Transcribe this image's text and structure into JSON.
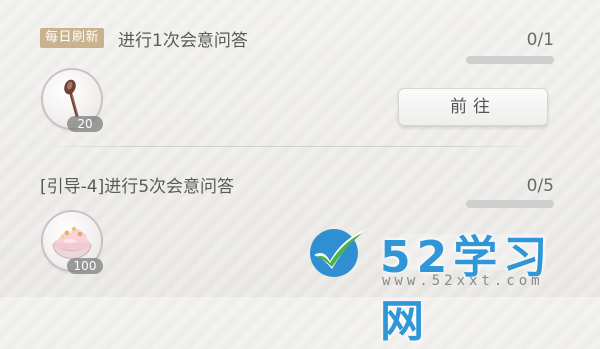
{
  "tasks": [
    {
      "badge": "每日刷新",
      "title": "进行1次会意问答",
      "progress_text": "0/1",
      "progress": 0,
      "reward": {
        "icon": "spoon-icon",
        "count": "20"
      },
      "button_label": "前往"
    },
    {
      "title": "[引导-4]进行5次会意问答",
      "progress_text": "0/5",
      "progress": 0,
      "reward": {
        "icon": "dessert-icon",
        "count": "100"
      }
    }
  ],
  "watermark": {
    "text": "52学习网",
    "url": "www.52xxt.com"
  },
  "colors": {
    "badge": "#c9b28e",
    "watermark": "#2f97d7"
  }
}
